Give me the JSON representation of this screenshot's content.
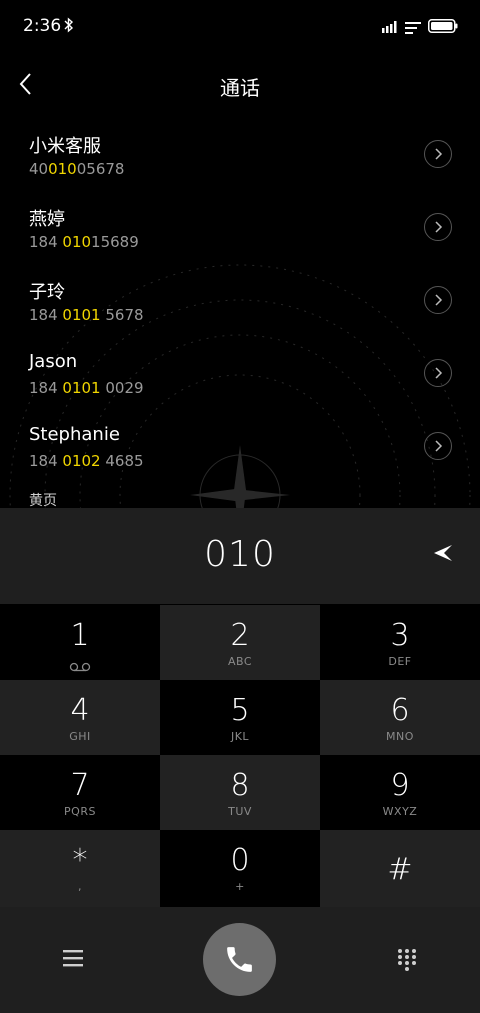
{
  "status_bar": {
    "time": "2:36",
    "icons": [
      "bluetooth-icon",
      "signal-icon",
      "notification-icon",
      "battery-icon"
    ]
  },
  "header": {
    "title": "通话",
    "back_icon": "chevron-left-icon"
  },
  "contacts": [
    {
      "name": "小米客服",
      "number_pre": "40",
      "number_hl": "010",
      "number_post": "05678"
    },
    {
      "name": "燕婷",
      "number_pre": "184 ",
      "number_hl": "010",
      "number_post": "15689"
    },
    {
      "name": "子玲",
      "number_pre": "184 ",
      "number_hl": "0101",
      "number_post": " 5678"
    },
    {
      "name": "Jason",
      "number_pre": "184 ",
      "number_hl": "0101",
      "number_post": " 0029"
    },
    {
      "name": "Stephanie",
      "number_pre": "184 ",
      "number_hl": "0102",
      "number_post": " 4685"
    }
  ],
  "section_label": "黄页",
  "dial": {
    "number": "010",
    "backspace_icon": "backspace-icon"
  },
  "keypad": [
    {
      "digit": "1",
      "letters": ""
    },
    {
      "digit": "2",
      "letters": "ABC"
    },
    {
      "digit": "3",
      "letters": "DEF"
    },
    {
      "digit": "4",
      "letters": "GHI"
    },
    {
      "digit": "5",
      "letters": "JKL"
    },
    {
      "digit": "6",
      "letters": "MNO"
    },
    {
      "digit": "7",
      "letters": "PQRS"
    },
    {
      "digit": "8",
      "letters": "TUV"
    },
    {
      "digit": "9",
      "letters": "WXYZ"
    },
    {
      "digit": "*",
      "letters": ","
    },
    {
      "digit": "0",
      "letters": "+"
    },
    {
      "digit": "#",
      "letters": ""
    }
  ],
  "bottom_bar": {
    "menu_icon": "menu-icon",
    "call_icon": "phone-icon",
    "keypad_icon": "dialpad-icon"
  },
  "colors": {
    "highlight": "#f1d600",
    "background": "#000000",
    "panel": "#1f1f1f",
    "call_button": "#6d6d6d"
  }
}
